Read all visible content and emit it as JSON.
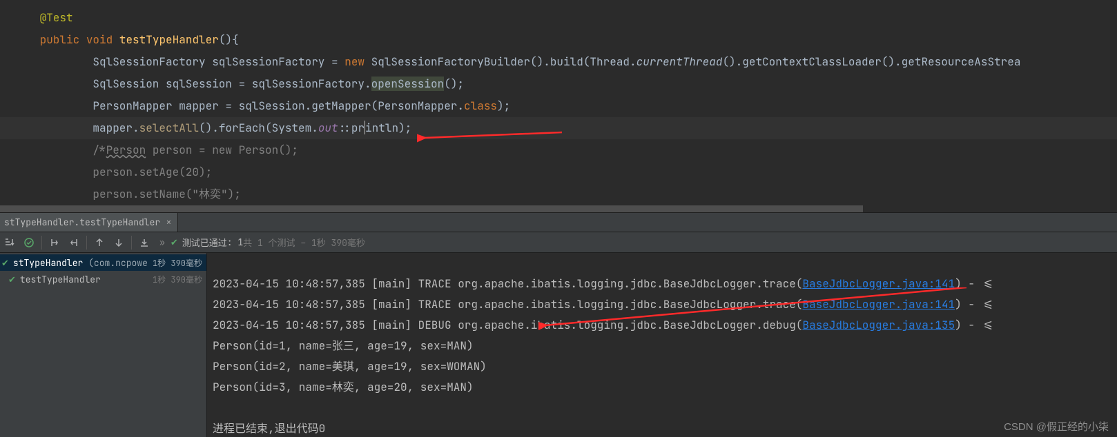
{
  "code": {
    "indent1": "      ",
    "indent2": "         ",
    "indent3": "              ",
    "annotation": "@Test",
    "kw_public": "public",
    "kw_void": "void",
    "method_name": "testTypeHandler",
    "empty_parens_brace": "(){",
    "l3_a": "SqlSessionFactory sqlSessionFactory = ",
    "kw_new": "new",
    "l3_b": " SqlSessionFactoryBuilder().build(Thread.",
    "l3_italic": "currentThread",
    "l3_c": "().getContextClassLoader().getResourceAsStrea",
    "l4_a": "SqlSession sqlSession = sqlSessionFactory.",
    "l4_hl": "openSession",
    "l4_b": "();",
    "l5_a": "PersonMapper mapper = sqlSession.getMapper(PersonMapper.",
    "kw_class": "class",
    "l5_b": ");",
    "l6_a": "mapper.",
    "l6_m1": "selectAll",
    "l6_b": "().forEach(System.",
    "l6_static": "out",
    "l6_c": "::pr",
    "l6_d": "intln);",
    "l7_a": "/*",
    "l7_wavy": "Person",
    "l7_b": " person = new Person();",
    "l8": "person.setAge(20);",
    "l9_a": "person.setName(",
    "l9_str": "\"林奕\"",
    "l9_b": ");"
  },
  "tab": {
    "label": "stTypeHandler.testTypeHandler"
  },
  "toolbar": {
    "status_prefix": "测试 ",
    "status_pass": "已通过",
    "status_count": ": 1",
    "status_dim": "共 1 个测试 – 1秒 390毫秒"
  },
  "tree": {
    "row1_name": "stTypeHandler",
    "row1_pkg": " (com.ncpowe",
    "row1_time": "1秒 390毫秒",
    "row2_name": "testTypeHandler",
    "row2_time": "1秒 390毫秒"
  },
  "console": {
    "l1a": "2023-04-15 10:48:57,385 [main] TRACE org.apache.ibatis.logging.jdbc.BaseJdbcLogger.trace(",
    "l1link": "BaseJdbcLogger.java:141",
    "l1b": ") - <=",
    "l2a": "2023-04-15 10:48:57,385 [main] TRACE org.apache.ibatis.logging.jdbc.BaseJdbcLogger.trace(",
    "l2link": "BaseJdbcLogger.java:141",
    "l2b": ") - <=",
    "l3a": "2023-04-15 10:48:57,385 [main] DEBUG org.apache.ibatis.logging.jdbc.BaseJdbcLogger.debug(",
    "l3link": "BaseJdbcLogger.java:135",
    "l3b": ") - <=",
    "l4": "Person(id=1, name=张三, age=19, sex=MAN)",
    "l5": "Person(id=2, name=美琪, age=19, sex=WOMAN)",
    "l6": "Person(id=3, name=林奕, age=20, sex=MAN)",
    "blank": "",
    "l8": "进程已结束,退出代码0"
  },
  "watermark": "CSDN @假正经的小柒"
}
